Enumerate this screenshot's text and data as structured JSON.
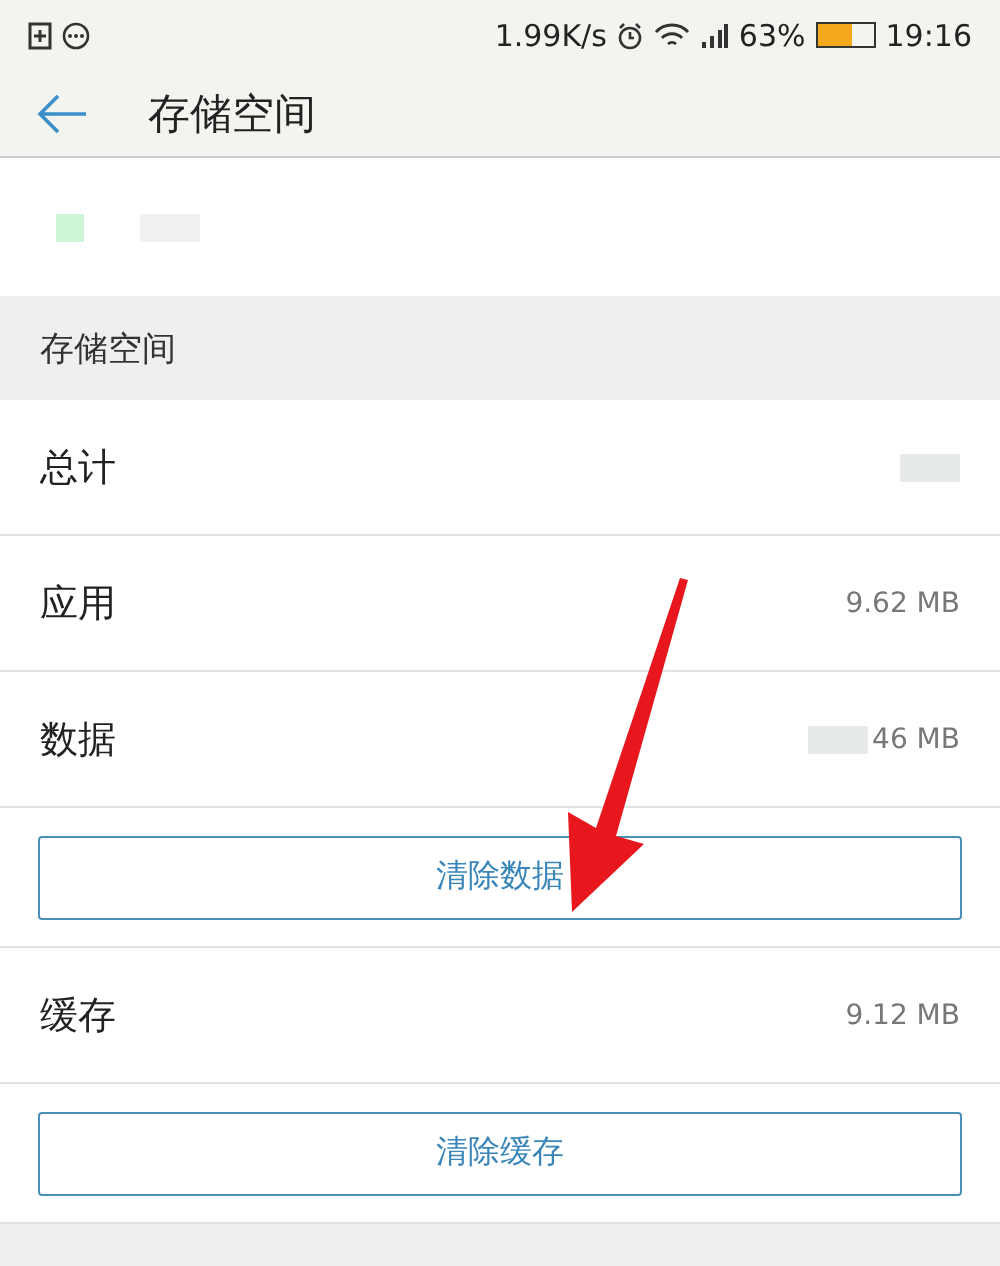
{
  "status_bar": {
    "speed": "1.99K/s",
    "battery_percent": "63%",
    "time": "19:16"
  },
  "toolbar": {
    "title": "存储空间"
  },
  "section": {
    "title": "存储空间"
  },
  "rows": [
    {
      "kind": "value",
      "label": "总计",
      "redacted": true
    },
    {
      "kind": "value",
      "label": "应用",
      "value": "9.62 MB",
      "redacted": false
    },
    {
      "kind": "value",
      "label": "数据",
      "value": "46 MB",
      "redacted": true
    },
    {
      "kind": "button",
      "label": "清除数据"
    },
    {
      "kind": "value",
      "label": "缓存",
      "value": "9.12 MB",
      "redacted": false
    },
    {
      "kind": "button",
      "label": "清除缓存"
    }
  ]
}
